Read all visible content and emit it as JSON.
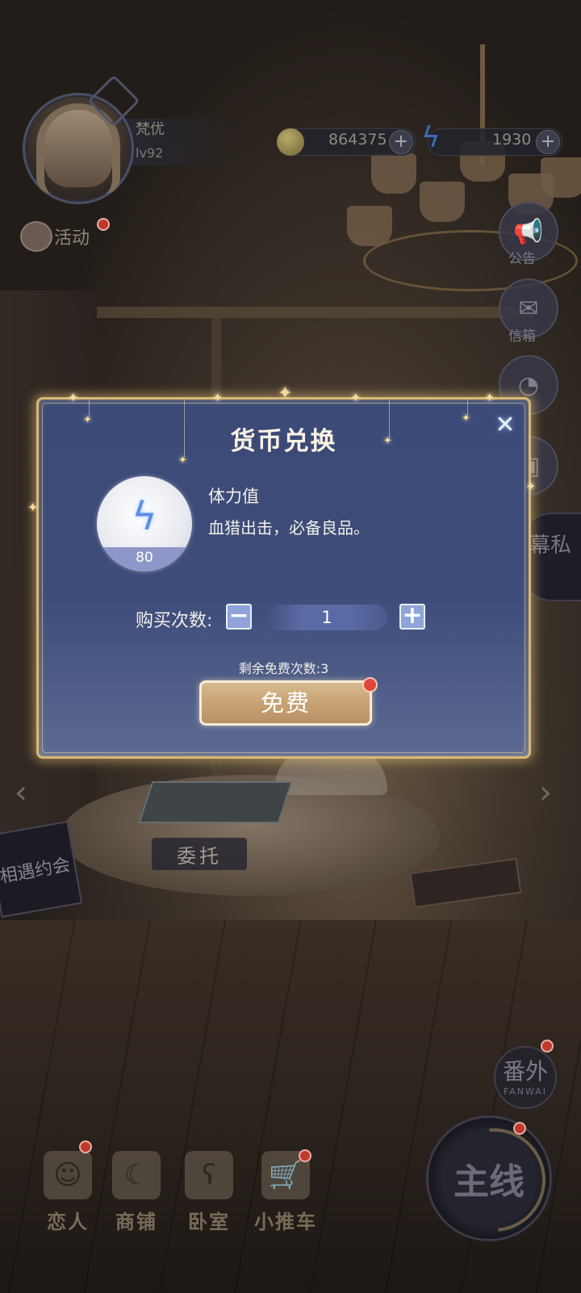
{
  "hud": {
    "player_name": "梵优",
    "player_level": "lv92",
    "coins": "864375",
    "energy": "1930",
    "activity_label": "活动"
  },
  "side_menu": {
    "notice_label": "公告",
    "mail_label": "信箱",
    "story_badge": "幕私"
  },
  "scene": {
    "commission_label": "委托",
    "sign_text": "相遇约会"
  },
  "modal": {
    "title": "货币兑换",
    "item_name": "体力值",
    "item_description": "血猎出击，必备良品。",
    "item_amount": "80",
    "quantity_label": "购买次数:",
    "quantity_value": "1",
    "free_remaining": "剩余免费次数:3",
    "free_button": "免费"
  },
  "bottom_nav": {
    "items": [
      {
        "label": "恋人",
        "icon": "lover-icon"
      },
      {
        "label": "商铺",
        "icon": "shop-bag-icon"
      },
      {
        "label": "卧室",
        "icon": "bedroom-hamster-icon"
      },
      {
        "label": "小推车",
        "icon": "cart-icon"
      }
    ],
    "extra_cn": "番外",
    "extra_en": "FANWAI",
    "main_story": "主线"
  },
  "colors": {
    "modal_bg": "#3e4c7a",
    "modal_border": "#d9b874",
    "free_button": "#c7a274",
    "red_dot": "#e0483a"
  }
}
